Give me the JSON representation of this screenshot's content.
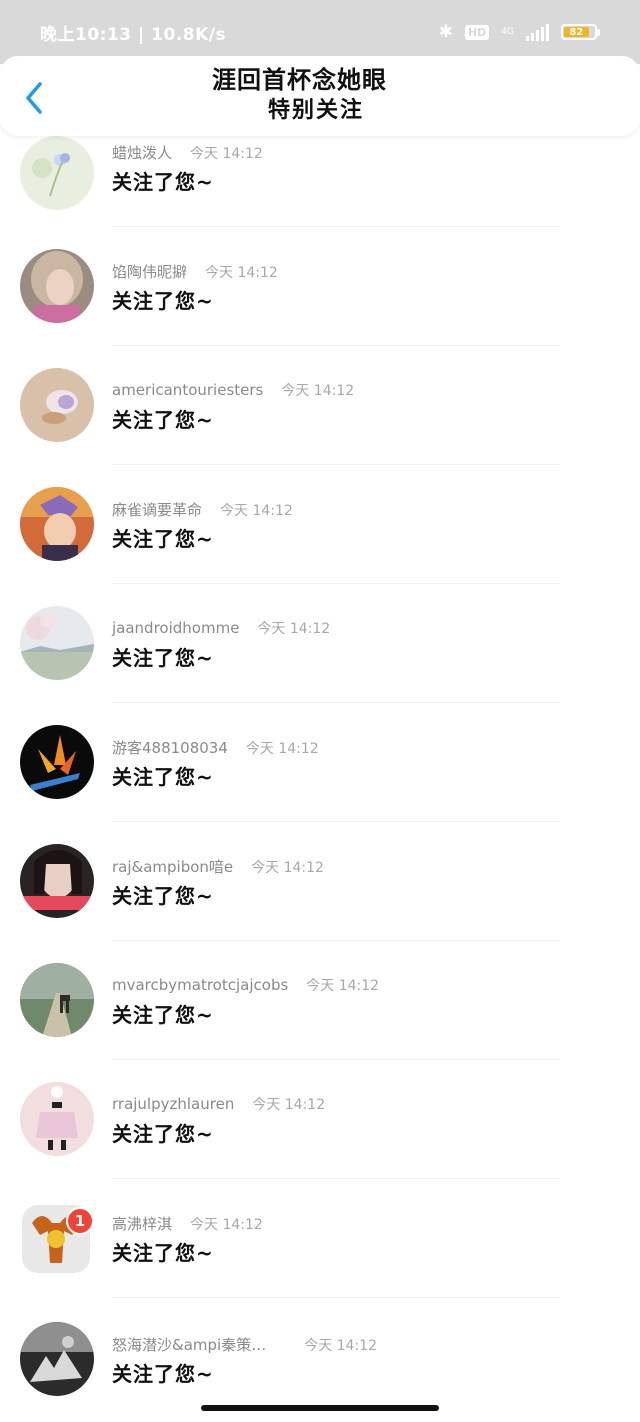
{
  "status_bar": {
    "time_speed": "晚上10:13 | 10.8K/s",
    "hd": "HD",
    "network": "4G",
    "battery": "82"
  },
  "header": {
    "back_icon": "chevron-left-icon",
    "line1": "涯回首杯念她眼",
    "title": "特别关注"
  },
  "notifications": [
    {
      "name": "蜡烛泼人",
      "time": "今天 14:12",
      "message": "关注了您~",
      "avatar": "dandelion"
    },
    {
      "name": "馅陶伟昵擗",
      "time": "今天 14:12",
      "message": "关注了您~",
      "avatar": "girl-hair"
    },
    {
      "name": "americantouriesters",
      "time": "今天 14:12",
      "message": "关注了您~",
      "avatar": "shell"
    },
    {
      "name": "麻雀谪要革命",
      "time": "今天 14:12",
      "message": "关注了您~",
      "avatar": "anime"
    },
    {
      "name": "jaandroidhomme",
      "time": "今天 14:12",
      "message": "关注了您~",
      "avatar": "blossom"
    },
    {
      "name": "游客488108034",
      "time": "今天 14:12",
      "message": "关注了您~",
      "avatar": "flower"
    },
    {
      "name": "raj&ampibon喑e",
      "time": "今天 14:12",
      "message": "关注了您~",
      "avatar": "girl-dark"
    },
    {
      "name": "mvarcbymatrotcjajcobs",
      "time": "今天 14:12",
      "message": "关注了您~",
      "avatar": "deer"
    },
    {
      "name": "rrajulpyzhlauren",
      "time": "今天 14:12",
      "message": "关注了您~",
      "avatar": "pink-dress"
    },
    {
      "name": "高沸梓淇",
      "time": "今天 14:12",
      "message": "关注了您~",
      "avatar": "cartoon",
      "badge": "1"
    },
    {
      "name": "怒海潜沙&ampi秦策…",
      "time": "今天 14:12",
      "message": "关注了您~",
      "avatar": "bw-scene"
    }
  ]
}
